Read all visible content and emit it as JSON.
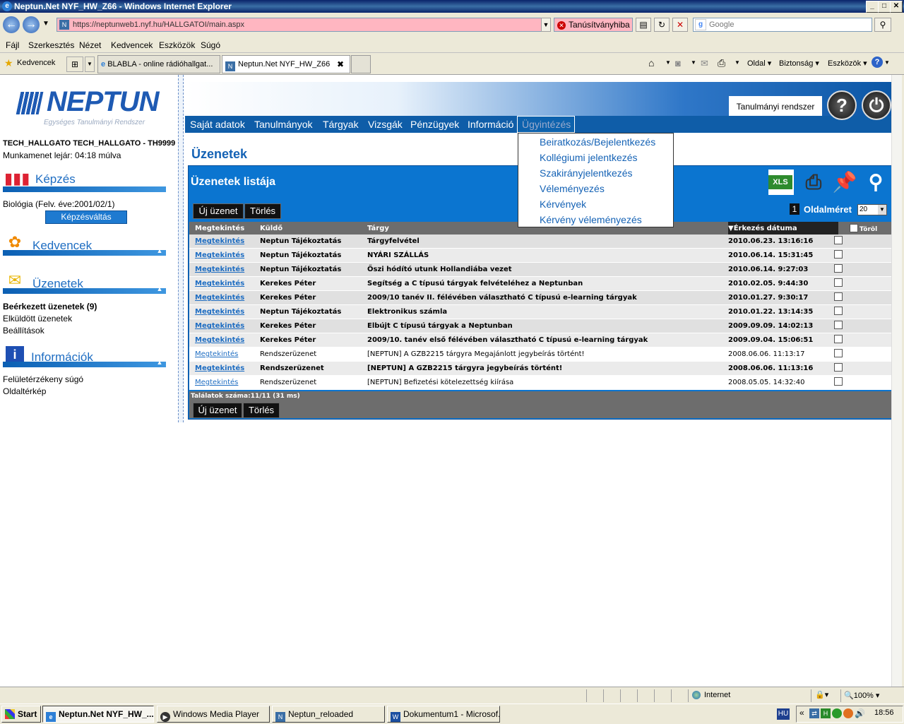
{
  "window": {
    "title": "Neptun.Net NYF_HW_Z66 - Windows Internet Explorer"
  },
  "address": {
    "url": "https://neptunweb1.nyf.hu/HALLGATOI/main.aspx",
    "cert_error": "Tanúsítványhiba",
    "search_placeholder": "Google"
  },
  "menubar": [
    "Fájl",
    "Szerkesztés",
    "Nézet",
    "Kedvencek",
    "Eszközök",
    "Súgó"
  ],
  "favorites_label": "Kedvencek",
  "tabs": [
    {
      "label": "BLABLA - online rádióhallgat..."
    },
    {
      "label": "Neptun.Net NYF_HW_Z66",
      "close": "✖"
    }
  ],
  "ie_toolbar": {
    "page": "Oldal",
    "safety": "Biztonság",
    "tools": "Eszközök"
  },
  "logo": {
    "word": "NEPTUN",
    "subtitle": "Egységes Tanulmányi Rendszer"
  },
  "user": {
    "name": "TECH_HALLGATO TECH_HALLGATO - TH9999",
    "session": "Munkamenet lejár: 04:18 múlva"
  },
  "left": {
    "kepzes": {
      "title": "Képzés",
      "program": "Biológia (Felv. éve:2001/02/1)",
      "switch_button": "Képzésváltás"
    },
    "kedvencek": {
      "title": "Kedvencek"
    },
    "uzenetek": {
      "title": "Üzenetek",
      "items": [
        "Beérkezett üzenetek (9)",
        "Elküldött üzenetek",
        "Beállítások"
      ]
    },
    "informaciok": {
      "title": "Információk",
      "items": [
        "Felületérzékeny súgó",
        "Oldaltérkép"
      ]
    }
  },
  "header": {
    "system_label": "Tanulmányi rendszer"
  },
  "nav": [
    "Saját adatok",
    "Tanulmányok",
    "Tárgyak",
    "Vizsgák",
    "Pénzügyek",
    "Információ",
    "Ügyintézés"
  ],
  "dropdown": [
    "Beiratkozás/Bejelentkezés",
    "Kollégiumi jelentkezés",
    "Szakirányjelentkezés",
    "Véleményezés",
    "Kérvények",
    "Kérvény véleményezés"
  ],
  "main": {
    "title": "Üzenetek",
    "list_title": "Üzenetek listája",
    "new_button": "Új üzenet",
    "delete_button": "Törlés",
    "current_page": "1",
    "page_size_label": "Oldalméret",
    "page_size": "20",
    "export_icon_label": "XLS",
    "columns": {
      "view": "Megtekintés",
      "sender": "Küldő",
      "subject": "Tárgy",
      "date": "▼Érkezés dátuma",
      "delete": "Töröl"
    },
    "rows": [
      {
        "view": "Megtekintés",
        "sender": "Neptun Tájékoztatás",
        "subject": "Tárgyfelvétel",
        "date": "2010.06.23. 13:16:16",
        "unread": true
      },
      {
        "view": "Megtekintés",
        "sender": "Neptun Tájékoztatás",
        "subject": "NYÁRI SZÁLLÁS",
        "date": "2010.06.14. 15:31:45",
        "unread": true
      },
      {
        "view": "Megtekintés",
        "sender": "Neptun Tájékoztatás",
        "subject": "Őszi hódító utunk Hollandiába vezet",
        "date": "2010.06.14. 9:27:03",
        "unread": true
      },
      {
        "view": "Megtekintés",
        "sender": "Kerekes Péter",
        "subject": "Segítség a C típusú tárgyak felvételéhez a Neptunban",
        "date": "2010.02.05. 9:44:30",
        "unread": true
      },
      {
        "view": "Megtekintés",
        "sender": "Kerekes Péter",
        "subject": "2009/10 tanév II. félévében választható C típusú e-learning tárgyak",
        "date": "2010.01.27. 9:30:17",
        "unread": true
      },
      {
        "view": "Megtekintés",
        "sender": "Neptun Tájékoztatás",
        "subject": "Elektronikus számla",
        "date": "2010.01.22. 13:14:35",
        "unread": true
      },
      {
        "view": "Megtekintés",
        "sender": "Kerekes Péter",
        "subject": "Elbújt C típusú tárgyak a Neptunban",
        "date": "2009.09.09. 14:02:13",
        "unread": true
      },
      {
        "view": "Megtekintés",
        "sender": "Kerekes Péter",
        "subject": "2009/10. tanév első félévében választható C típusú e-learning tárgyak",
        "date": "2009.09.04. 15:06:51",
        "unread": true
      },
      {
        "view": "Megtekintés",
        "sender": "Rendszerüzenet",
        "subject": "[NEPTUN] A GZB2215 tárgyra Megajánlott jegybeírás történt!",
        "date": "2008.06.06. 11:13:17",
        "unread": false
      },
      {
        "view": "Megtekintés",
        "sender": "Rendszerüzenet",
        "subject": "[NEPTUN] A GZB2215 tárgyra jegybeírás történt!",
        "date": "2008.06.06. 11:13:16",
        "unread": true
      },
      {
        "view": "Megtekintés",
        "sender": "Rendszerüzenet",
        "subject": "[NEPTUN] Befizetési kötelezettség kiírása",
        "date": "2008.05.05. 14:32:40",
        "unread": false
      }
    ],
    "result_count": "Találatok száma:11/11 (31 ms)"
  },
  "statusbar": {
    "zone": "Internet",
    "zoom": "100%"
  },
  "taskbar": {
    "start": "Start",
    "tasks": [
      "Neptun.Net NYF_HW_...",
      "Windows Media Player",
      "Neptun_reloaded",
      "Dokumentum1 - Microsof..."
    ],
    "lang": "HU",
    "clock": "18:56"
  }
}
